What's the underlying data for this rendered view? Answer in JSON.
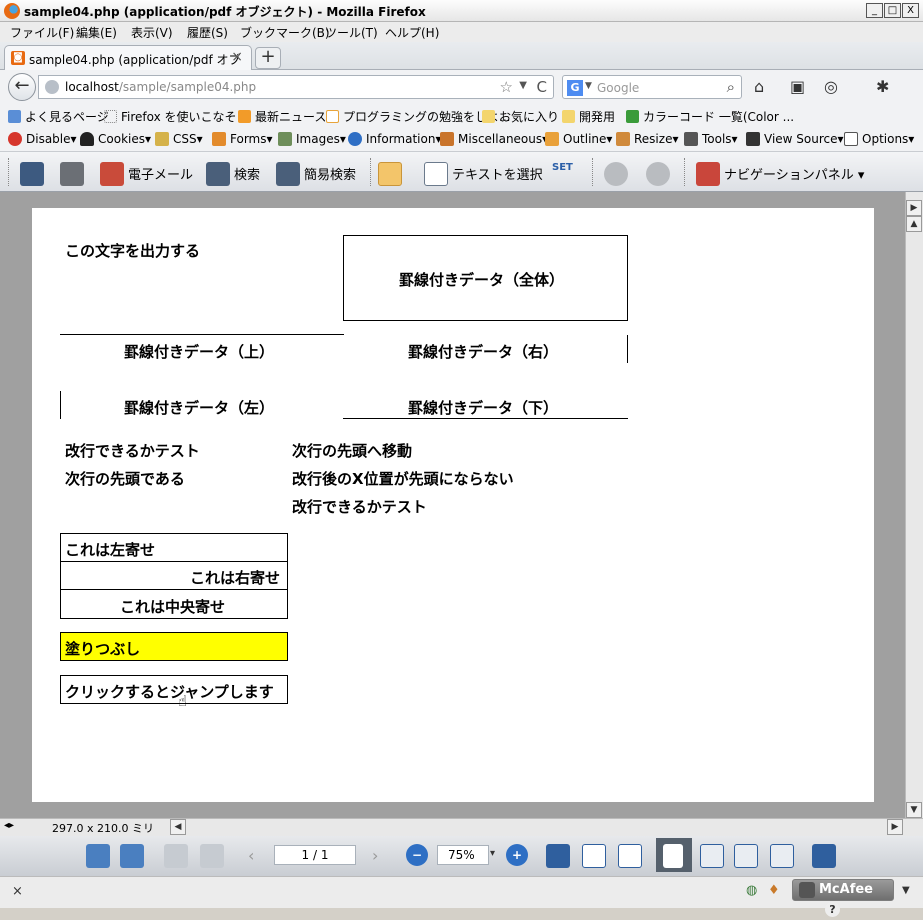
{
  "window": {
    "title": "sample04.php (application/pdf オブジェクト) - Mozilla Firefox",
    "min": "_",
    "max": "□",
    "close": "X"
  },
  "menu": [
    "ファイル(F)",
    "編集(E)",
    "表示(V)",
    "履歴(S)",
    "ブックマーク(B)",
    "ツール(T)",
    "ヘルプ(H)"
  ],
  "tab": {
    "label": "sample04.php (application/pdf オブジェクト)",
    "close": "×",
    "new": "+"
  },
  "nav": {
    "back": "←",
    "url_host": "localhost",
    "url_path": "/sample/sample04.php",
    "search_placeholder": "Google",
    "star": "☆",
    "drop": "▼",
    "reload": "C",
    "search_icon": "⌕"
  },
  "bookmarks": [
    "よく見るページ",
    "Firefox を使いこなそう",
    "最新ニュース",
    "プログラミングの勉強をしよ...",
    "お気に入り",
    "開発用",
    "カラーコード 一覧(Color ..."
  ],
  "devbar": [
    "Disable▾",
    "Cookies▾",
    "CSS▾",
    "Forms▾",
    "Images▾",
    "Information▾",
    "Miscellaneous▾",
    "Outline▾",
    "Resize▾",
    "Tools▾",
    "View Source▾",
    "Options▾"
  ],
  "pdftool": {
    "email": "電子メール",
    "search": "検索",
    "easy_search": "簡易検索",
    "select_text": "テキストを選択",
    "set": "SET",
    "nav_panel": "ナビゲーションパネル",
    "drop": "▾"
  },
  "pdf": {
    "t1": "この文字を出力する",
    "all": "罫線付きデータ（全体）",
    "top": "罫線付きデータ（上）",
    "right": "罫線付きデータ（右）",
    "left": "罫線付きデータ（左）",
    "bottom": "罫線付きデータ（下）",
    "nl1": "改行できるかテスト",
    "nl2": "次行の先頭である",
    "nr1": "次行の先頭へ移動",
    "nr2": "改行後のX位置が先頭にならない",
    "nr3": "改行できるかテスト",
    "align_left": "これは左寄せ",
    "align_right": "これは右寄せ",
    "align_center": "これは中央寄せ",
    "fill": "塗りつぶし",
    "link": "クリックするとジャンプします"
  },
  "colors": {
    "fill": "#ffff00"
  },
  "footer": {
    "size": "297.0 x 210.0 ミリ",
    "page": "1 / 1",
    "zoom": "75%",
    "zoom_drop": "▾"
  },
  "status": {
    "close": "×",
    "mcafee": "McAfee",
    "help": "?"
  }
}
